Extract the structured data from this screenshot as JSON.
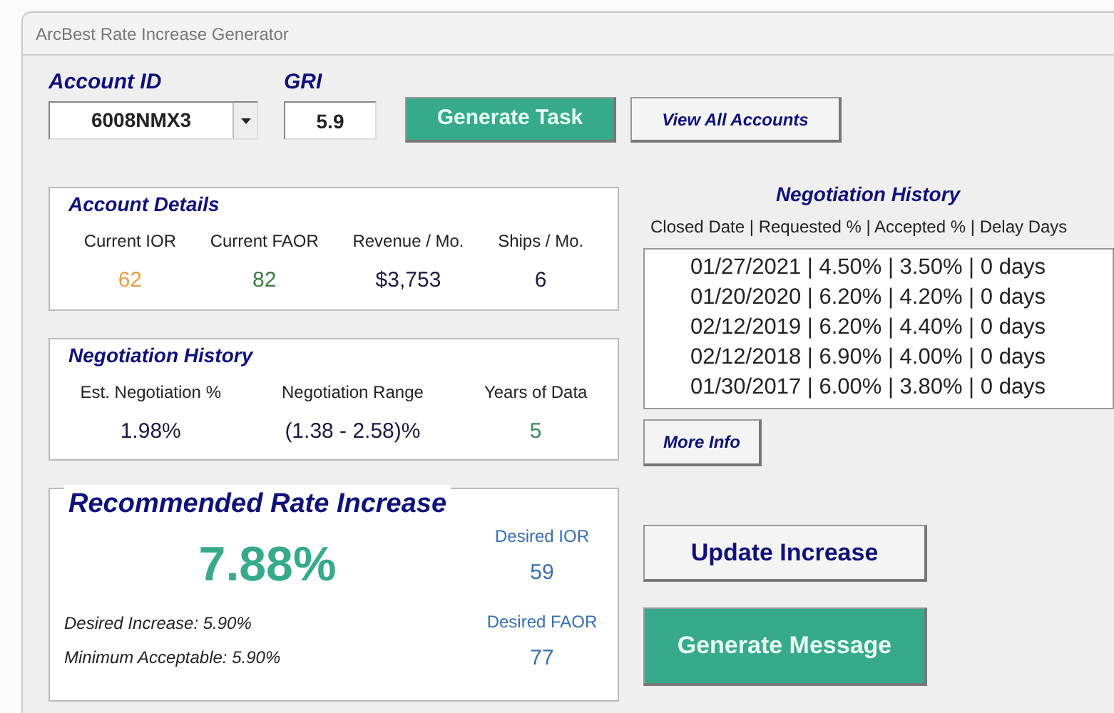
{
  "window": {
    "title": "ArcBest Rate Increase Generator"
  },
  "account": {
    "label": "Account ID",
    "value": "6008NMX3"
  },
  "gri": {
    "label": "GRI",
    "value": "5.9"
  },
  "top_buttons": [
    {
      "label": "Generate Task",
      "kind": "accent"
    },
    {
      "label": "View All Accounts",
      "kind": "plain"
    }
  ],
  "account_details": {
    "title": "Account Details",
    "fields": [
      {
        "label": "Current IOR",
        "value": "62",
        "color": "#e0a246"
      },
      {
        "label": "Current FAOR",
        "value": "82",
        "color": "#3d7a45"
      },
      {
        "label": "Revenue / Mo.",
        "value": "$3,753",
        "color": "#1a1a40"
      },
      {
        "label": "Ships / Mo.",
        "value": "6",
        "color": "#1a1a40"
      }
    ]
  },
  "negotiation_summary": {
    "title": "Negotiation History",
    "fields": [
      {
        "label": "Est. Negotiation %",
        "value": "1.98%",
        "color": "#1a1a40"
      },
      {
        "label": "Negotiation Range",
        "value": "(1.38 - 2.58)%",
        "color": "#1a1a40"
      },
      {
        "label": "Years of Data",
        "value": "5",
        "color": "#3d8a5a"
      }
    ]
  },
  "recommended": {
    "title": "Recommended Rate Increase",
    "value": "7.88%",
    "notes": [
      "Desired Increase: 5.90%",
      "Minimum Acceptable: 5.90%"
    ],
    "targets": [
      {
        "label": "Desired IOR",
        "value": "59"
      },
      {
        "label": "Desired FAOR",
        "value": "77"
      }
    ]
  },
  "history": {
    "title": "Negotiation History",
    "header": "Closed Date | Requested % | Accepted % | Delay Days",
    "rows": [
      "01/27/2021 | 4.50% | 3.50% | 0 days",
      "01/20/2020 | 6.20% | 4.20% | 0 days",
      "02/12/2019 | 6.20% | 4.40% | 0 days",
      "02/12/2018 | 6.90% | 4.00% | 0 days",
      "01/30/2017 | 6.00% | 3.80% | 0 days"
    ],
    "more_button": "More Info"
  },
  "actions": [
    {
      "label": "Update Increase",
      "kind": "plain"
    },
    {
      "label": "Generate Message",
      "kind": "accent"
    }
  ]
}
